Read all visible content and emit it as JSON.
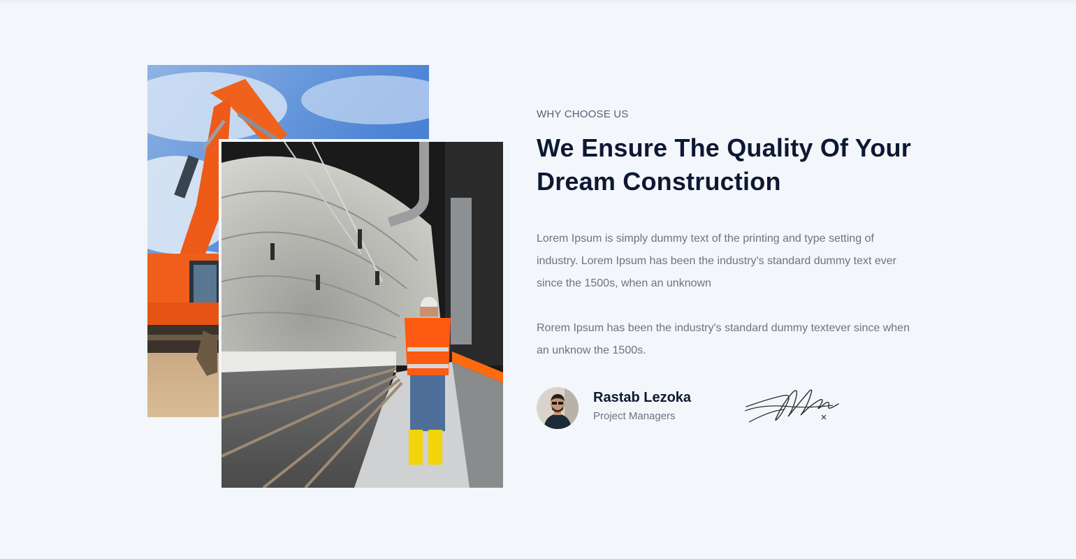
{
  "section": {
    "eyebrow": "WHY CHOOSE US",
    "heading": "We Ensure The Quality Of Your Dream Construction",
    "paragraphs": [
      "Lorem Ipsum is simply dummy text of the printing and type setting of industry. Lorem Ipsum has been the industry's standard dummy text ever since the 1500s, when an unknown",
      "Rorem Ipsum has been the industry's standard dummy textever since when an unknow the 1500s."
    ]
  },
  "images": {
    "back": "excavator-photo",
    "front": "tunnel-worker-photo"
  },
  "author": {
    "name": "Rastab Lezoka",
    "role": "Project Managers",
    "avatar": "avatar-photo",
    "signature": "signature-image"
  },
  "colors": {
    "background": "#f3f6fb",
    "heading": "#0d1833",
    "body_text": "#6d7381",
    "accent_orange": "#f05a1a"
  }
}
